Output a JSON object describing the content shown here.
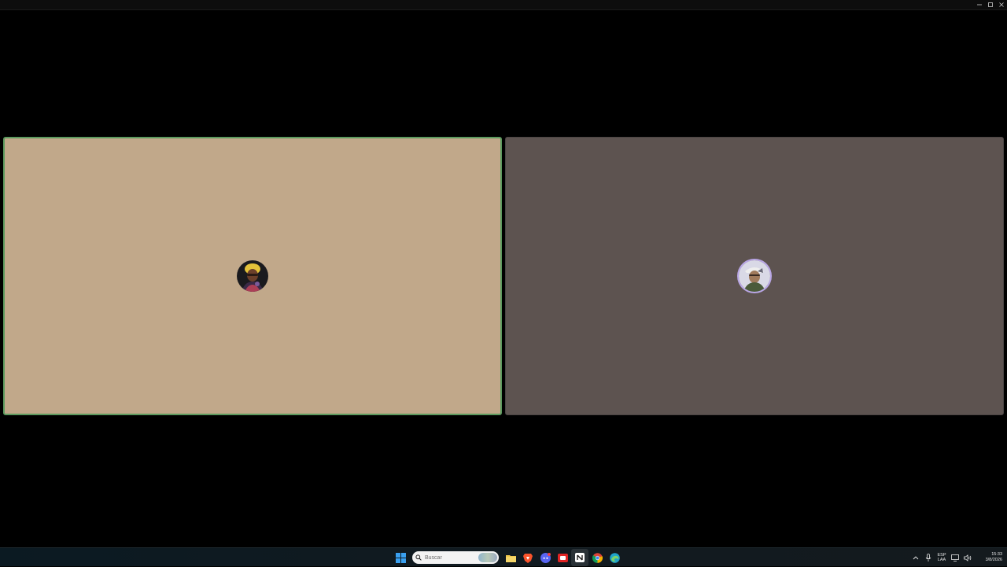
{
  "call": {
    "participants": [
      {
        "tile_color": "#c1a88a",
        "speaking": true,
        "speaking_border": "#5c9a5e"
      },
      {
        "tile_color": "#5d5350",
        "speaking": false
      }
    ]
  },
  "window_controls": [
    "minimize-icon",
    "maximize-icon",
    "close-icon"
  ],
  "taskbar": {
    "search": {
      "placeholder": "Buscar"
    },
    "pinned_icons": [
      "windows-start-icon",
      "brave-browser-icon",
      "file-explorer-icon",
      "discord-icon",
      "red-app-icon",
      "notion-icon",
      "chrome-icon",
      "edge-icon"
    ],
    "tray": {
      "language_line1": "ESP",
      "language_line2": "LAA",
      "time": "15:33",
      "date": "3/8/2026"
    }
  }
}
